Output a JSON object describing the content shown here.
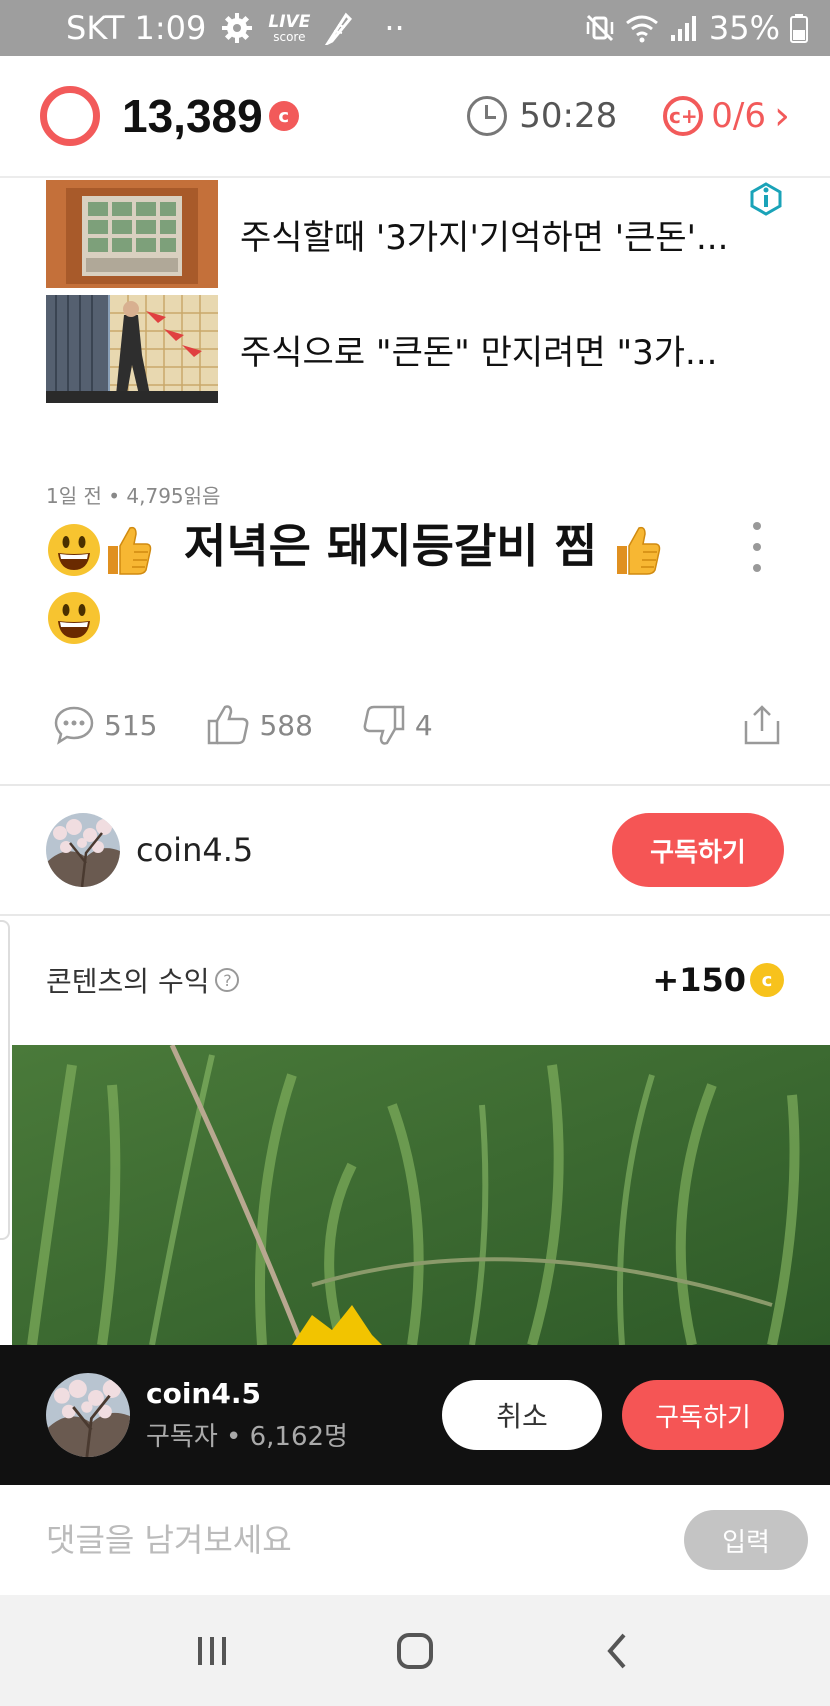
{
  "status_bar": {
    "carrier_time": "SKT 1:09",
    "live_label": "LIVE",
    "score_label": "score",
    "dots": "··",
    "battery": "35%"
  },
  "top_bar": {
    "points": "13,389",
    "coin_symbol": "c",
    "timer": "50:28",
    "mission_symbol": "c+",
    "missions": "0/6",
    "chevron": "›"
  },
  "ads": [
    {
      "text": "주식할때 '3가지'기억하면 '큰돈'..."
    },
    {
      "text": "주식으로 \"큰돈\" 만지려면 \"3가..."
    }
  ],
  "article": {
    "meta": "1일 전 • 4,795읽음",
    "title": "저녁은 돼지등갈비 찜",
    "reactions": {
      "comments": "515",
      "likes": "588",
      "dislikes": "4"
    }
  },
  "author": {
    "name": "coin4.5",
    "subscribe_label": "구독하기"
  },
  "earnings": {
    "label": "콘텐츠의 수익",
    "help_symbol": "?",
    "value": "+150",
    "coin_symbol": "c"
  },
  "popup": {
    "name": "coin4.5",
    "subscribers": "구독자 • 6,162명",
    "cancel_label": "취소",
    "subscribe_label": "구독하기"
  },
  "comment_bar": {
    "placeholder": "댓글을 남겨보세요",
    "submit_label": "입력"
  },
  "colors": {
    "accent": "#f55555",
    "coin_yellow": "#f7c21c"
  },
  "icons": {
    "ring": "ring-icon",
    "clock": "clock-icon",
    "mission": "coin-plus-icon",
    "comment": "comment-icon",
    "like": "thumbs-up-icon",
    "dislike": "thumbs-down-icon",
    "share": "share-icon",
    "more": "more-vertical-icon",
    "info": "ad-info-icon"
  }
}
